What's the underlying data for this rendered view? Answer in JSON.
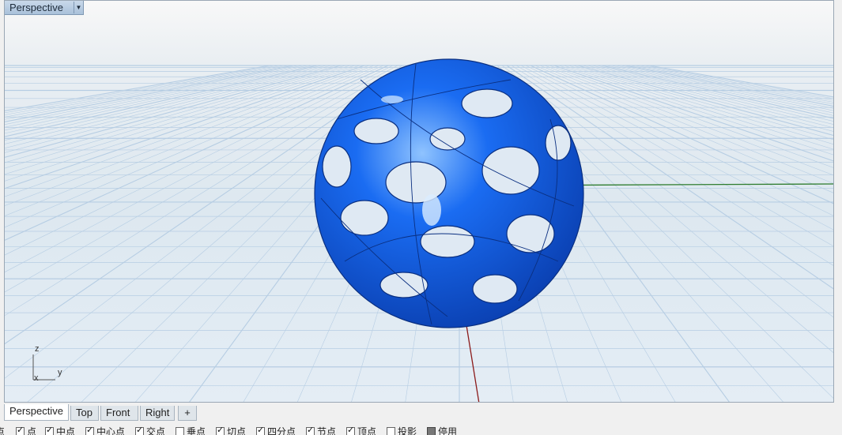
{
  "viewport": {
    "title": "Perspective",
    "menu_arrow": "▼",
    "axis_labels": {
      "z": "z",
      "y": "y",
      "x": "x"
    },
    "colors": {
      "object": "#1a6cf2",
      "grid": "#b6cde3",
      "x_axis": "#8b1a1a",
      "y_axis": "#2f7d2f"
    }
  },
  "tabs": [
    {
      "label": "Perspective",
      "active": true
    },
    {
      "label": "Top",
      "active": false
    },
    {
      "label": "Front",
      "active": false
    },
    {
      "label": "Right",
      "active": false
    }
  ],
  "add_tab_icon": "+",
  "snaps": {
    "leading": "点",
    "items": [
      {
        "label": "点",
        "checked": true
      },
      {
        "label": "中点",
        "checked": true
      },
      {
        "label": "中心点",
        "checked": true
      },
      {
        "label": "交点",
        "checked": true
      },
      {
        "label": "垂点",
        "checked": false
      },
      {
        "label": "切点",
        "checked": true
      },
      {
        "label": "四分点",
        "checked": true
      },
      {
        "label": "节点",
        "checked": true
      },
      {
        "label": "顶点",
        "checked": true
      },
      {
        "label": "投影",
        "checked": false
      },
      {
        "label": "停用",
        "checked": false,
        "dark": true
      }
    ]
  }
}
